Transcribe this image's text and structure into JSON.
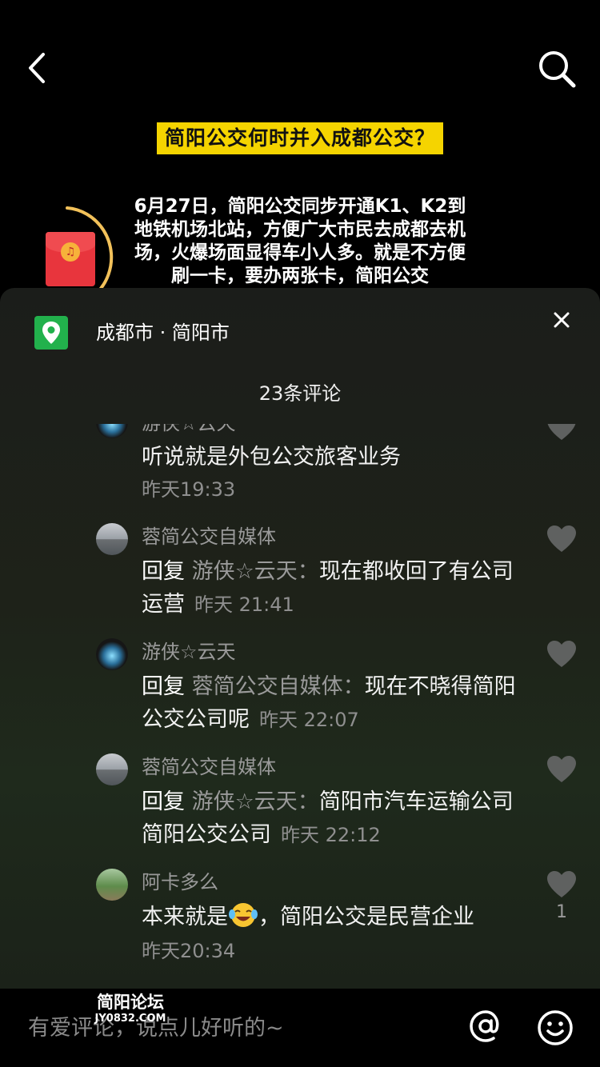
{
  "video": {
    "title": "简阳公交何时并入成都公交？",
    "caption": "6月27日，简阳公交同步开通K1、K2到地铁机场北站，方便广大市民去成都去机场，火爆场面显得车小人多。就是不方便刷一卡，要办两张卡，简阳公交"
  },
  "icons": {
    "back": "chevron-left-icon",
    "search": "search-icon",
    "redpacket": "red-packet-icon",
    "location": "location-pin-icon",
    "close": "close-icon",
    "like": "heart-icon",
    "at": "at-icon",
    "emoji": "smiley-icon"
  },
  "location": {
    "text": "成都市 · 简阳市"
  },
  "header": {
    "count_label": "23条评论"
  },
  "comments": [
    {
      "user": "游侠☆云天",
      "text": "听说就是外包公交旅客业务",
      "time": "昨天19:33",
      "likes": ""
    },
    {
      "user": "蓉简公交自媒体",
      "reply_prefix": "回复",
      "reply_to": "游侠☆云天：",
      "text": "现在都收回了有公司运营",
      "time": "昨天 21:41",
      "likes": ""
    },
    {
      "user": "游侠☆云天",
      "reply_prefix": "回复",
      "reply_to": "蓉简公交自媒体：",
      "text": "现在不晓得简阳公交公司呢",
      "time": "昨天 22:07",
      "likes": ""
    },
    {
      "user": "蓉简公交自媒体",
      "reply_prefix": "回复",
      "reply_to": "游侠☆云天：",
      "text": "简阳市汽车运输公司简阳公交公司",
      "time": "昨天 22:12",
      "likes": ""
    },
    {
      "user": "阿卡多么",
      "text_before": "本来就是",
      "text_after": "，简阳公交是民营企业",
      "time": "昨天20:34",
      "likes": "1"
    }
  ],
  "input": {
    "placeholder": "有爱评论，说点儿好听的~"
  },
  "watermark": {
    "line1": "简阳论坛",
    "line2": "JY0832.COM"
  },
  "colors": {
    "accent_yellow": "#f5d400",
    "location_green": "#22b14c",
    "redpacket_red": "#e8353d"
  }
}
